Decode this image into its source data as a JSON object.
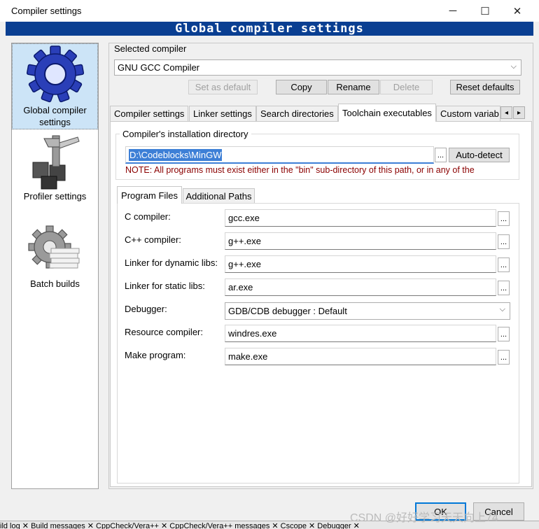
{
  "window": {
    "title": "Compiler settings",
    "minimize": "─",
    "maximize": "☐",
    "close": "✕"
  },
  "banner": "Global compiler settings",
  "categories": [
    {
      "label": "Global compiler settings",
      "icon": "gear-icon",
      "selected": true
    },
    {
      "label": "Profiler settings",
      "icon": "caliper-icon",
      "selected": false
    },
    {
      "label": "Batch builds",
      "icon": "batch-gear-icon",
      "selected": false
    }
  ],
  "selected_compiler": {
    "label": "Selected compiler",
    "value": "GNU GCC Compiler",
    "buttons": {
      "set_default": "Set as default",
      "copy": "Copy",
      "rename": "Rename",
      "delete": "Delete",
      "reset": "Reset defaults"
    }
  },
  "tabs": [
    "Compiler settings",
    "Linker settings",
    "Search directories",
    "Toolchain executables",
    "Custom variab"
  ],
  "tab_scroll": {
    "left": "◂",
    "right": "▸"
  },
  "install": {
    "label": "Compiler's installation directory",
    "path": "D:\\Codeblocks\\MinGW",
    "browse": "...",
    "autodetect": "Auto-detect",
    "note": "NOTE: All programs must exist either in the \"bin\" sub-directory of this path, or in any of the"
  },
  "subtabs": [
    "Program Files",
    "Additional Paths"
  ],
  "programs": {
    "c_label": "C compiler:",
    "c_value": "gcc.exe",
    "cpp_label": "C++ compiler:",
    "cpp_value": "g++.exe",
    "dyn_label": "Linker for dynamic libs:",
    "dyn_value": "g++.exe",
    "static_label": "Linker for static libs:",
    "static_value": "ar.exe",
    "dbg_label": "Debugger:",
    "dbg_value": "GDB/CDB debugger : Default",
    "res_label": "Resource compiler:",
    "res_value": "windres.exe",
    "make_label": "Make program:",
    "make_value": "make.exe",
    "browse": "..."
  },
  "footer": {
    "ok": "OK",
    "cancel": "Cancel"
  },
  "bottom_bar": "ild log ✕   Build messages ✕   CppCheck/Vera++ ✕   CppCheck/Vera++ messages ✕   Cscope ✕   Debugger ✕",
  "watermark": "CSDN @好好学习天天向上74",
  "colors": {
    "banner": "#0a3f92",
    "note": "#8b0000",
    "selection": "#3d7fd6"
  }
}
